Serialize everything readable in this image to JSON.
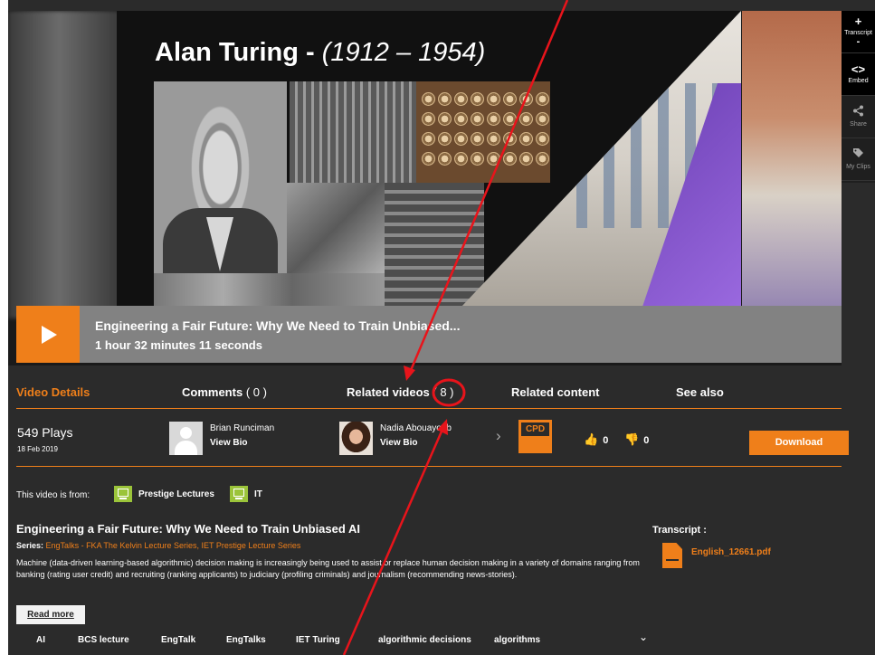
{
  "slide": {
    "title_name": "Alan Turing",
    "title_sep": " - ",
    "title_years": "(1912 – 1954)"
  },
  "rail": {
    "transcript_plus": "+",
    "transcript": "Transcript",
    "transcript_minus": "-",
    "embed_icon": "<>",
    "embed": "Embed",
    "share": "Share",
    "myclips": "My Clips"
  },
  "player": {
    "title": "Engineering a Fair Future: Why We Need to Train Unbiased...",
    "duration": "1 hour 32 minutes 11 seconds"
  },
  "tabs": {
    "video_details": "Video Details",
    "comments_label": "Comments",
    "comments_count": "( 0 )",
    "related_videos_label": "Related videos",
    "related_videos_count": "( 8 )",
    "related_content": "Related content",
    "see_also": "See also"
  },
  "meta": {
    "plays": "549 Plays",
    "date": "18 Feb 2019",
    "speakers": [
      {
        "name": "Brian Runciman",
        "bio_link": "View Bio"
      },
      {
        "name": "Nadia Abouayoub",
        "bio_link": "View Bio"
      }
    ],
    "next_arrow": "›",
    "cpd": "CPD",
    "likes": "0",
    "dislikes": "0",
    "download": "Download"
  },
  "source": {
    "label": "This video is from:",
    "items": [
      "Prestige Lectures",
      "IT"
    ]
  },
  "details": {
    "title": "Engineering a Fair Future: Why We Need to Train Unbiased AI",
    "series_label": "Series:",
    "series_links": [
      "EngTalks - FKA The Kelvin Lecture Series",
      "IET Prestige Lecture Series"
    ],
    "series_sep": ", ",
    "description": "Machine (data-driven learning-based algorithmic) decision making is increasingly being used to assist or replace human decision making in a variety of domains ranging from banking (rating user credit) and recruiting (ranking applicants) to judiciary (profiling criminals) and journalism (recommending news-stories).",
    "read_more": "Read more"
  },
  "transcript": {
    "label": "Transcript :",
    "file": "English_12661.pdf"
  },
  "tags": [
    "AI",
    "BCS lecture",
    "EngTalk",
    "EngTalks",
    "IET Turing",
    "algorithmic decisions",
    "algorithms"
  ],
  "tags_expand": "⌄",
  "colors": {
    "accent": "#ef7f1a",
    "background": "#2b2b2b",
    "annotation": "#e8141b"
  }
}
